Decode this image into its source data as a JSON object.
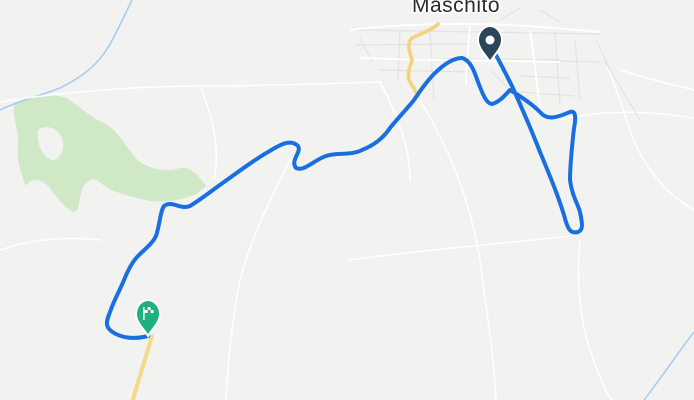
{
  "map": {
    "town_label": "Maschito",
    "route_color": "#1a6fe0",
    "start_marker_color": "#1fb17d",
    "end_marker_color": "#2c4458",
    "park_color": "#cfe8c6",
    "water_color": "#a9cdf0",
    "major_road_color": "#f5d98b"
  }
}
